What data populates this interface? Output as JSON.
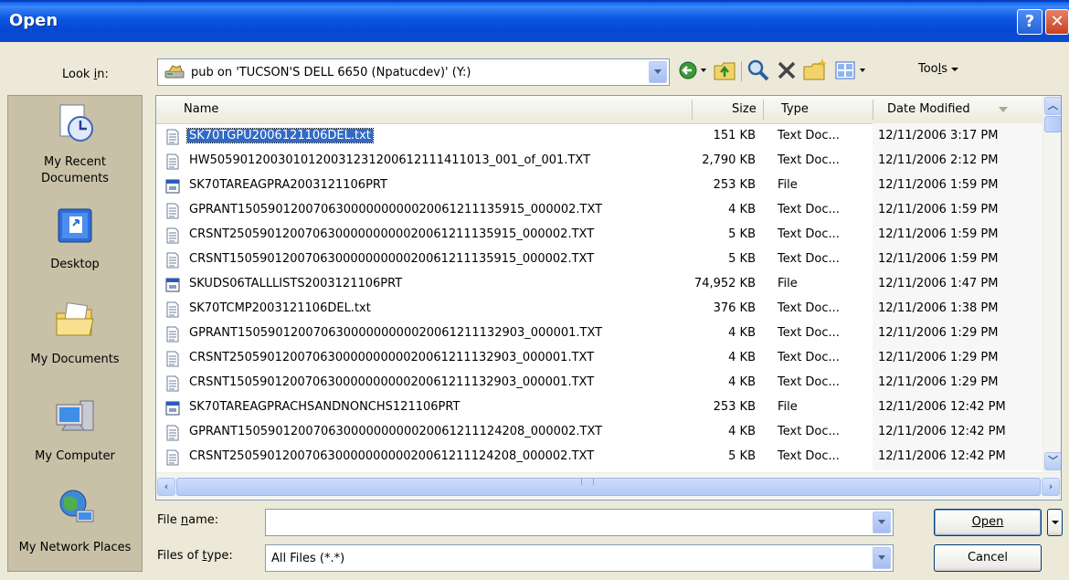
{
  "window": {
    "title": "Open",
    "help_glyph": "?",
    "close_glyph": "✕"
  },
  "lookin": {
    "label": "Look in:",
    "value": "pub on 'TUCSON'S DELL 6650 (Npatucdev)' (Y:)",
    "icon": "network-drive-icon"
  },
  "toolbar": {
    "tools_label": "Tools"
  },
  "places": [
    {
      "label": "My Recent Documents",
      "icon": "recent-documents-icon"
    },
    {
      "label": "Desktop",
      "icon": "desktop-icon"
    },
    {
      "label": "My Documents",
      "icon": "my-documents-icon"
    },
    {
      "label": "My Computer",
      "icon": "my-computer-icon"
    },
    {
      "label": "My Network Places",
      "icon": "network-places-icon"
    }
  ],
  "columns": {
    "name": "Name",
    "size": "Size",
    "type": "Type",
    "date": "Date Modified"
  },
  "files": [
    {
      "name": "SK70TGPU2006121106DEL.txt",
      "size": "151 KB",
      "type": "Text Doc...",
      "date": "12/11/2006 3:17 PM",
      "icon": "text-file-icon",
      "selected": true
    },
    {
      "name": "HW5059012003010120031231200612111411013_001_of_001.TXT",
      "size": "2,790 KB",
      "type": "Text Doc...",
      "date": "12/11/2006 2:12 PM",
      "icon": "text-file-icon"
    },
    {
      "name": "SK70TAREAGPRA2003121106PRT",
      "size": "253 KB",
      "type": "File",
      "date": "12/11/2006 1:59 PM",
      "icon": "generic-file-icon"
    },
    {
      "name": "GPRANT15059012007063000000000020061211135915_000002.TXT",
      "size": "4 KB",
      "type": "Text Doc...",
      "date": "12/11/2006 1:59 PM",
      "icon": "text-file-icon"
    },
    {
      "name": "CRSNT25059012007063000000000020061211135915_000002.TXT",
      "size": "5 KB",
      "type": "Text Doc...",
      "date": "12/11/2006 1:59 PM",
      "icon": "text-file-icon"
    },
    {
      "name": "CRSNT15059012007063000000000020061211135915_000002.TXT",
      "size": "5 KB",
      "type": "Text Doc...",
      "date": "12/11/2006 1:59 PM",
      "icon": "text-file-icon"
    },
    {
      "name": "SKUDS06TALLLISTS2003121106PRT",
      "size": "74,952 KB",
      "type": "File",
      "date": "12/11/2006 1:47 PM",
      "icon": "generic-file-icon"
    },
    {
      "name": "SK70TCMP2003121106DEL.txt",
      "size": "376 KB",
      "type": "Text Doc...",
      "date": "12/11/2006 1:38 PM",
      "icon": "text-file-icon"
    },
    {
      "name": "GPRANT15059012007063000000000020061211132903_000001.TXT",
      "size": "4 KB",
      "type": "Text Doc...",
      "date": "12/11/2006 1:29 PM",
      "icon": "text-file-icon"
    },
    {
      "name": "CRSNT25059012007063000000000020061211132903_000001.TXT",
      "size": "4 KB",
      "type": "Text Doc...",
      "date": "12/11/2006 1:29 PM",
      "icon": "text-file-icon"
    },
    {
      "name": "CRSNT15059012007063000000000020061211132903_000001.TXT",
      "size": "4 KB",
      "type": "Text Doc...",
      "date": "12/11/2006 1:29 PM",
      "icon": "text-file-icon"
    },
    {
      "name": "SK70TAREAGPRACHSANDNONCHS121106PRT",
      "size": "253 KB",
      "type": "File",
      "date": "12/11/2006 12:42 PM",
      "icon": "generic-file-icon"
    },
    {
      "name": "GPRANT15059012007063000000000020061211124208_000002.TXT",
      "size": "4 KB",
      "type": "Text Doc...",
      "date": "12/11/2006 12:42 PM",
      "icon": "text-file-icon"
    },
    {
      "name": "CRSNT25059012007063000000000020061211124208_000002.TXT",
      "size": "5 KB",
      "type": "Text Doc...",
      "date": "12/11/2006 12:42 PM",
      "icon": "text-file-icon"
    }
  ],
  "filename": {
    "label": "File name:",
    "value": ""
  },
  "filetype": {
    "label": "Files of type:",
    "value": "All Files (*.*)"
  },
  "buttons": {
    "open": "Open",
    "cancel": "Cancel"
  },
  "colors": {
    "titlebar": "#0548d4",
    "selection": "#316ac5",
    "dialog_bg": "#ece9d8"
  }
}
